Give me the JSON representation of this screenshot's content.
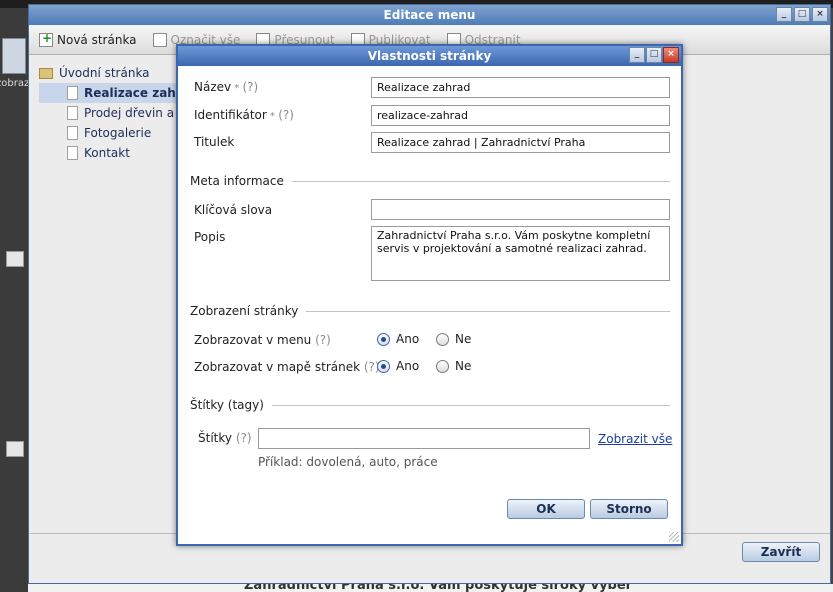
{
  "outer": {
    "title": "Editace menu",
    "toolbar": [
      {
        "label": "Nová stránka",
        "disabled": false
      },
      {
        "label": "Označit vše",
        "disabled": true
      },
      {
        "label": "Přesunout",
        "disabled": true
      },
      {
        "label": "Publikovat",
        "disabled": true
      },
      {
        "label": "Odstranit",
        "disabled": true
      }
    ],
    "tree": {
      "root": "Úvodní stránka",
      "children": [
        "Realizace zahr",
        "Prodej dřevin a k",
        "Fotogalerie",
        "Kontakt"
      ]
    },
    "close_label": "Zavřít"
  },
  "background": {
    "left_label": "zobraz",
    "bottom_text": "Zahradnictví Praha s.r.o. Vám poskytuje široký výběr"
  },
  "dialog": {
    "title": "Vlastnosti stránky",
    "help": "(?)",
    "fields": {
      "name_label": "Název",
      "name_value": "Realizace zahrad",
      "id_label": "Identifikátor",
      "id_value": "realizace-zahrad",
      "title_label": "Titulek",
      "title_value": "Realizace zahrad | Zahradnictví Praha"
    },
    "meta": {
      "section": "Meta informace",
      "keywords_label": "Klíčová slova",
      "keywords_value": "",
      "desc_label": "Popis",
      "desc_value": "Zahradnictví Praha s.r.o. Vám poskytne kompletní servis v projektování a samotné realizaci zahrad."
    },
    "display": {
      "section": "Zobrazení stránky",
      "menu_label": "Zobrazovat v menu",
      "sitemap_label": "Zobrazovat v mapě stránek",
      "yes": "Ano",
      "no": "Ne",
      "menu_selected": "Ano",
      "sitemap_selected": "Ano"
    },
    "tags": {
      "section": "Štítky (tagy)",
      "label": "Štítky",
      "value": "",
      "show_all": "Zobrazit vše",
      "example": "Příklad: dovolená, auto, práce"
    },
    "ok": "OK",
    "cancel": "Storno"
  },
  "colors": {
    "dialog_border": "#3a67b0",
    "link": "#1c3f9c"
  }
}
